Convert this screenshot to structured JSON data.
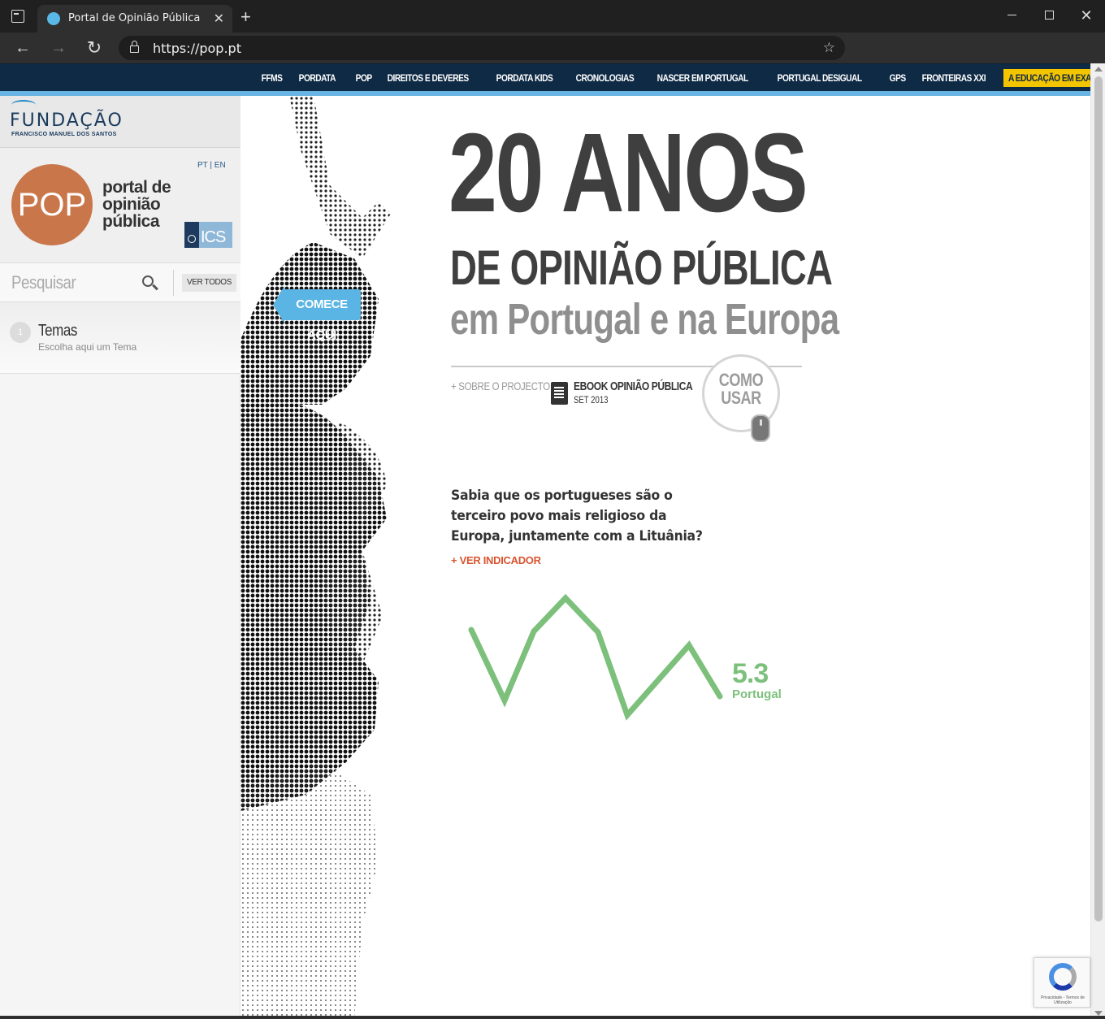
{
  "browser": {
    "tab_title": "Portal de Opinião Pública",
    "url": "https://pop.pt"
  },
  "site_nav": {
    "items": [
      "FFMS",
      "PORDATA",
      "POP",
      "DIREITOS E DEVERES",
      "PORDATA KIDS",
      "CRONOLOGIAS",
      "NASCER EM PORTUGAL",
      "PORTUGAL DESIGUAL",
      "GPS",
      "FRONTEIRAS XXI"
    ],
    "highlight": "A EDUCAÇÃO EM EXAME"
  },
  "sidebar": {
    "ffms_title": "FUNDAÇÃO",
    "ffms_subtitle": "FRANCISCO MANUEL DOS SANTOS",
    "lang_pt": "PT",
    "lang_sep": "|",
    "lang_en": "EN",
    "pop_logo": "POP",
    "pop_text_1": "portal de",
    "pop_text_2": "opinião",
    "pop_text_3": "pública",
    "ics_logo": "ICS",
    "search_placeholder": "Pesquisar",
    "ver_todos": "VER TODOS",
    "temas_number": "1",
    "temas_title": "Temas",
    "temas_subtitle": "Escolha aqui um Tema"
  },
  "hero": {
    "comece": "COMECE AQUI",
    "headline_1": "20 ANOS",
    "headline_2": "DE OPINIÃO PÚBLICA",
    "headline_3": "em Portugal e na Europa",
    "sobre_plus": "+",
    "sobre": "SOBRE O PROJECTO",
    "ebook_title": "EBOOK OPINIÃO PÚBLICA",
    "ebook_date": "SET 2013",
    "como_usar_1": "COMO",
    "como_usar_2": "USAR",
    "fact": "Sabia que os portugueses são o terceiro povo mais religioso da Europa, juntamente com a Lituânia?",
    "ver_indicador": "+ VER INDICADOR",
    "spark_value": "5.3",
    "spark_label": "Portugal",
    "spark_color": "#7cc07c"
  }
}
